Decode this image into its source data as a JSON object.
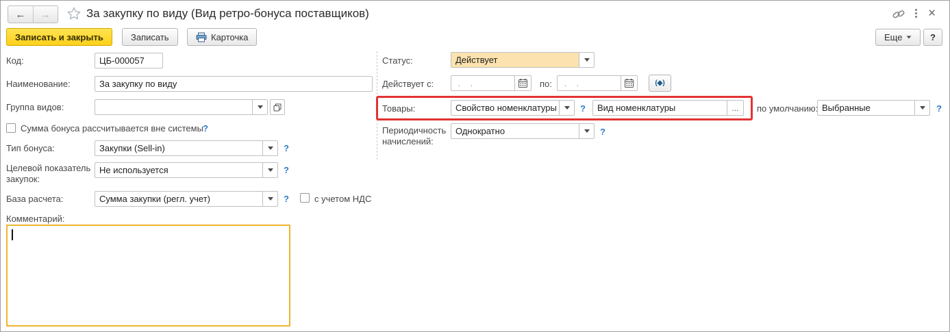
{
  "window": {
    "title": "За закупку по виду (Вид ретро-бонуса поставщиков)"
  },
  "icons": {
    "back": "←",
    "forward": "→",
    "close": "×",
    "help": "?",
    "ellipsis": "...",
    "period_picker": "(◆)"
  },
  "toolbar": {
    "save_close": "Записать и закрыть",
    "save": "Записать",
    "card": "Карточка",
    "more": "Еще"
  },
  "left": {
    "code": {
      "label": "Код:",
      "value": "ЦБ-000057"
    },
    "name": {
      "label": "Наименование:",
      "value": "За закупку по виду"
    },
    "group": {
      "label": "Группа видов:",
      "value": ""
    },
    "external_bonus": {
      "label": "Сумма бонуса рассчитывается вне системы",
      "checked": false
    },
    "bonus_type": {
      "label": "Тип бонуса:",
      "value": "Закупки (Sell-in)"
    },
    "target_indicator": {
      "label": "Целевой показатель закупок:",
      "value": "Не используется"
    },
    "calc_base": {
      "label": "База расчета:",
      "value": "Сумма закупки (регл. учет)",
      "vat_label": "с учетом НДС",
      "vat_checked": false
    },
    "comment": {
      "label": "Комментарий:",
      "value": ""
    }
  },
  "right": {
    "status": {
      "label": "Статус:",
      "value": "Действует"
    },
    "validity": {
      "label": "Действует с:",
      "from_value": " .    .  ",
      "to_label": "по:",
      "to_value": " .    .  "
    },
    "goods": {
      "label": "Товары:",
      "kind_value": "Свойство номенклатуры",
      "value": "Вид номенклатуры",
      "default_label": "по умолчанию:",
      "default_value": "Выбранные"
    },
    "periodicity": {
      "label": "Периодичность начислений:",
      "value": "Однократно"
    }
  },
  "colors": {
    "accent_yellow": "#FFD117",
    "status_fill": "#FBE2AE",
    "highlight_red": "#E23333",
    "focus_border": "#EDB52E",
    "help_blue": "#2D7CC8"
  }
}
